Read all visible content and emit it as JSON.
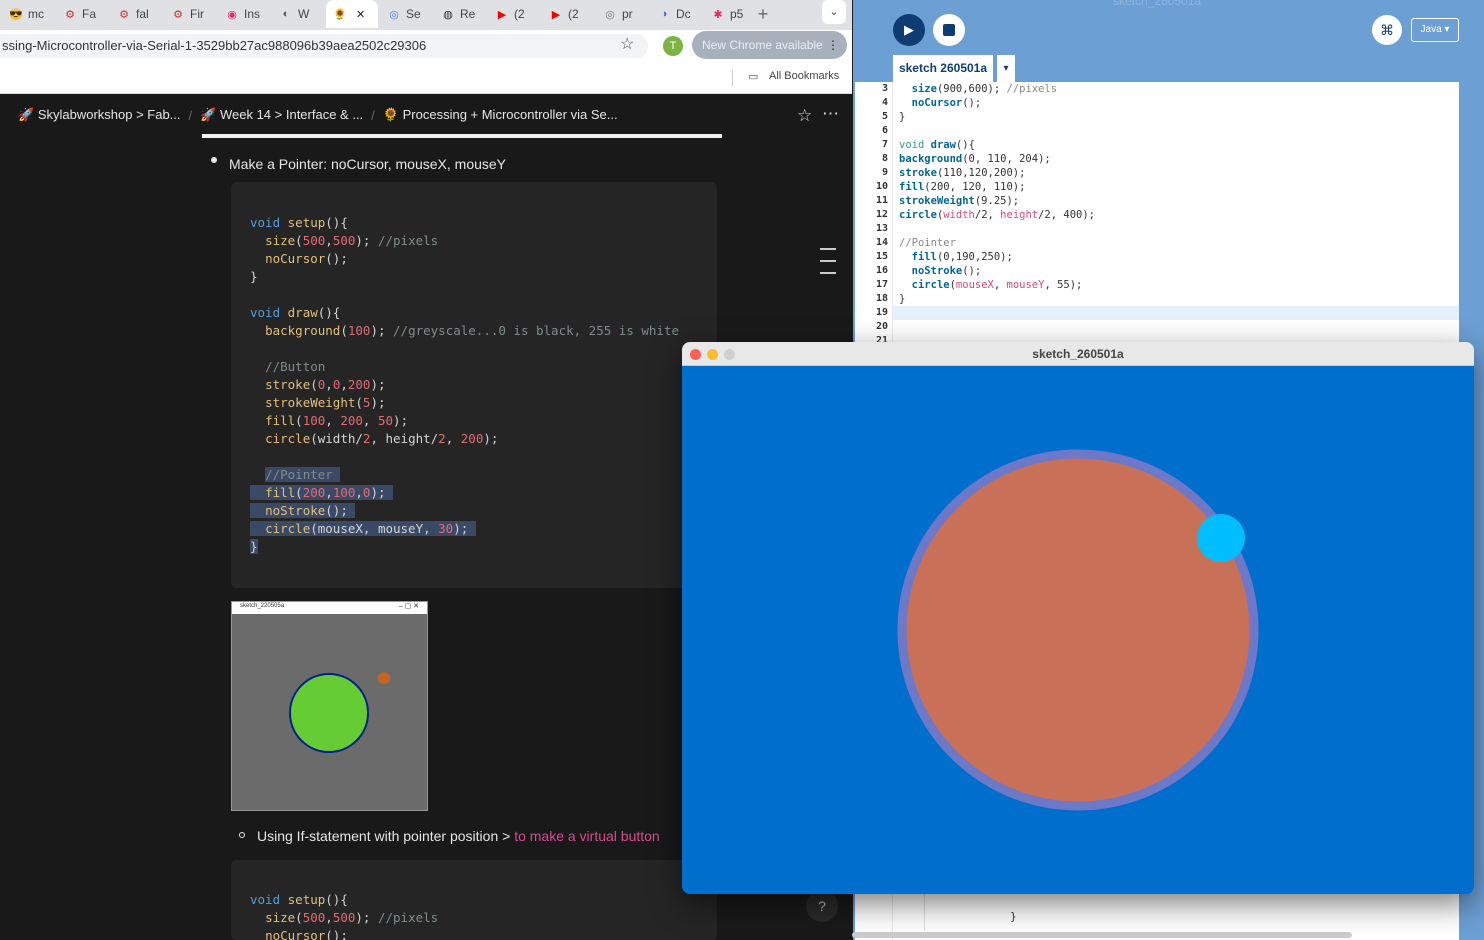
{
  "browser": {
    "tabs": [
      {
        "icon": "😎",
        "label": "mc",
        "color": "#ffd54f"
      },
      {
        "icon": "⚙",
        "label": "Fa",
        "color": "#c0392b"
      },
      {
        "icon": "⚙",
        "label": "fal",
        "color": "#c0392b"
      },
      {
        "icon": "⚙",
        "label": "Fir",
        "color": "#c0392b"
      },
      {
        "icon": "◉",
        "label": "Ins",
        "color": "#e1306c"
      },
      {
        "icon": "◐",
        "label": "W",
        "color": "#555"
      },
      {
        "icon": "🌻",
        "label": "",
        "color": "#f1c40f"
      },
      {
        "icon": "◎",
        "label": "Se",
        "color": "#4285f4"
      },
      {
        "icon": "◍",
        "label": "Re",
        "color": "#333"
      },
      {
        "icon": "▶",
        "label": "(2",
        "color": "#ff0000"
      },
      {
        "icon": "▶",
        "label": "(2",
        "color": "#ff0000"
      },
      {
        "icon": "◎",
        "label": "pr",
        "color": "#777"
      },
      {
        "icon": "◑",
        "label": "Dc",
        "color": "#4a6fd8"
      },
      {
        "icon": "✱",
        "label": "p5",
        "color": "#ed225d"
      }
    ],
    "active_tab_close": "✕",
    "new_tab": "+",
    "url": "ssing-Microcontroller-via-Serial-1-3529bb27ac988096b39aea2502c29306",
    "profile_initial": "T",
    "update_label": "New Chrome available",
    "bookmarks_label": "All Bookmarks"
  },
  "notion": {
    "breadcrumb": [
      {
        "icon": "🚀",
        "label": "Skylabworkshop > Fab..."
      },
      {
        "icon": "🚀",
        "label": "Week 14 > Interface & ..."
      },
      {
        "icon": "🌻",
        "label": "Processing + Microcontroller via Se..."
      }
    ],
    "bullet1": "Make a Pointer: noCursor, mouseX, mouseY",
    "sub_bullet_prefix": "Using If-statement with pointer position > ",
    "sub_bullet_link": "to make a virtual button",
    "thumb_title": "sketch_220505a",
    "help": "?"
  },
  "ide": {
    "title": "sketch_260501a",
    "tab_label": "sketch 260501a",
    "mode": "Java ▾",
    "line_numbers": [
      "3",
      "4",
      "5",
      "6",
      "7",
      "8",
      "9",
      "10",
      "11",
      "12",
      "13",
      "14",
      "15",
      "16",
      "17",
      "18",
      "19",
      "20",
      "21"
    ]
  },
  "sketch_window": {
    "title": "sketch_260501a",
    "background": "#006ecc",
    "circle_fill": "#c87058",
    "circle_stroke": "#6e78c8",
    "pointer_fill": "#00beff"
  }
}
